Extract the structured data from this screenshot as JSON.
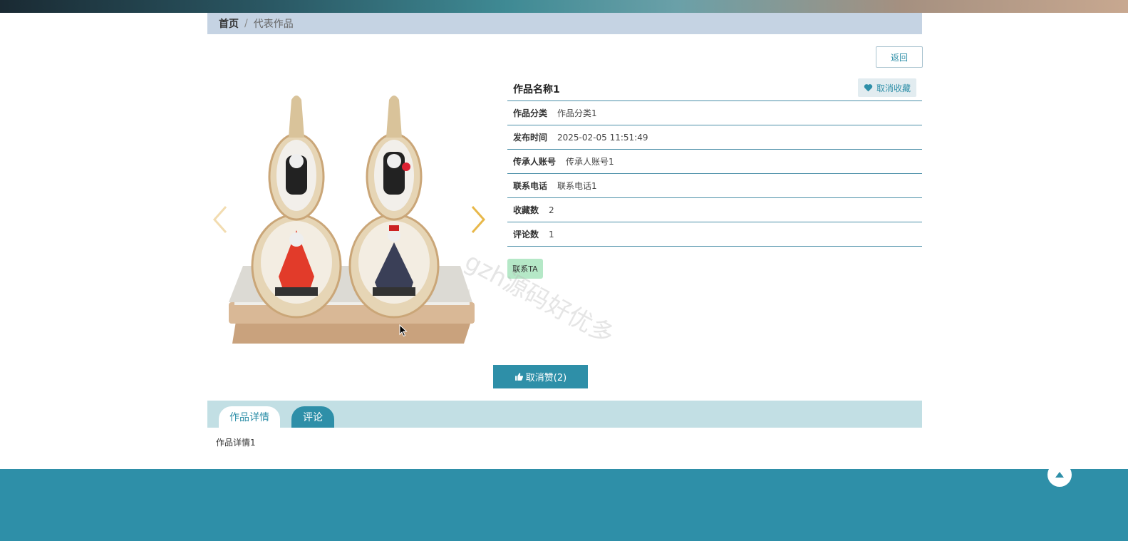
{
  "breadcrumb": {
    "home": "首页",
    "separator": "/",
    "current": "代表作品"
  },
  "back_button": "返回",
  "work": {
    "title": "作品名称1",
    "favorite_button": "取消收藏",
    "fields": [
      {
        "label": "作品分类",
        "value": "作品分类1"
      },
      {
        "label": "发布时间",
        "value": "2025-02-05 11:51:49"
      },
      {
        "label": "传承人账号",
        "value": "传承人账号1"
      },
      {
        "label": "联系电话",
        "value": "联系电话1"
      },
      {
        "label": "收藏数",
        "value": "2"
      },
      {
        "label": "评论数",
        "value": "1"
      }
    ],
    "contact_button": "联系TA"
  },
  "like_button": "取消赞(2)",
  "tabs": [
    {
      "label": "作品详情"
    },
    {
      "label": "评论"
    }
  ],
  "tab_content": "作品详情1",
  "watermark": "gzh源码好优多",
  "colors": {
    "accent": "#2e8fa8",
    "breadcrumb_bg": "#c5d3e3",
    "tabs_bg": "#c2dfe4",
    "contact_bg": "#b5e8c7",
    "arrow": "#e8b84a"
  },
  "icons": {
    "carousel_prev": "chevron-left-icon",
    "carousel_next": "chevron-right-icon",
    "favorite": "heart-icon",
    "like": "thumbs-up-icon",
    "back_to_top": "caret-up-icon"
  }
}
